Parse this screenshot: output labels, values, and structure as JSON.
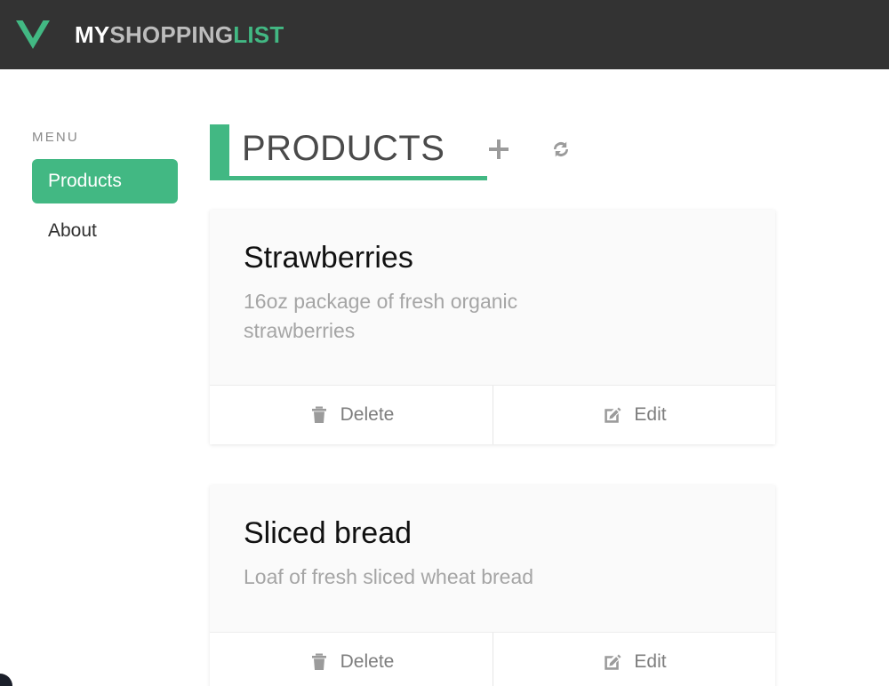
{
  "header": {
    "logo_icon": "vue-logo-icon",
    "brand": {
      "part1": "MY",
      "part2": "SHOPPING",
      "part3": "LIST"
    },
    "background_color": "#333333",
    "accent_color": "#42b883"
  },
  "sidebar": {
    "heading": "MENU",
    "items": [
      {
        "label": "Products",
        "active": true
      },
      {
        "label": "About",
        "active": false
      }
    ]
  },
  "main": {
    "page_title": "PRODUCTS",
    "actions": [
      {
        "name": "add-product-button",
        "icon": "plus-icon",
        "label": ""
      },
      {
        "name": "refresh-button",
        "icon": "refresh-icon",
        "label": ""
      }
    ],
    "cards": [
      {
        "title": "Strawberries",
        "description": "16oz package of fresh organic strawberries",
        "delete_label": "Delete",
        "edit_label": "Edit",
        "delete_icon": "trash-icon",
        "edit_icon": "pen-to-square-icon"
      },
      {
        "title": "Sliced bread",
        "description": "Loaf of fresh sliced wheat bread",
        "delete_label": "Delete",
        "edit_label": "Edit",
        "delete_icon": "trash-icon",
        "edit_icon": "pen-to-square-icon"
      }
    ]
  }
}
